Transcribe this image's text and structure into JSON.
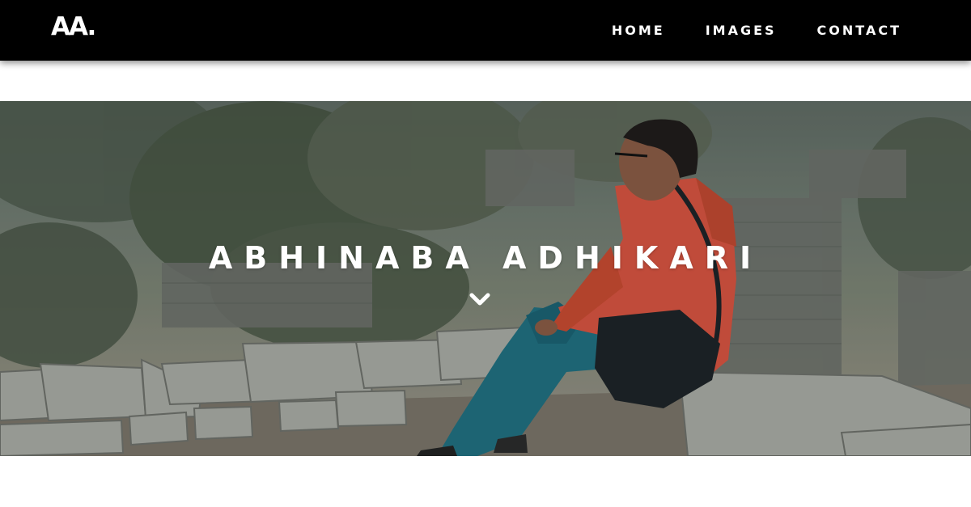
{
  "navbar": {
    "logo_text": "AA.",
    "links": [
      {
        "label": "HOME"
      },
      {
        "label": "IMAGES"
      },
      {
        "label": "CONTACT"
      }
    ],
    "background_color": "#000000"
  },
  "hero": {
    "title": "ABHINABA ADHIKARI",
    "scroll_icon": "chevron-down-icon",
    "photo_description_colors": {
      "jacket": "#d9533f",
      "jeans": "#1f6f80"
    }
  }
}
